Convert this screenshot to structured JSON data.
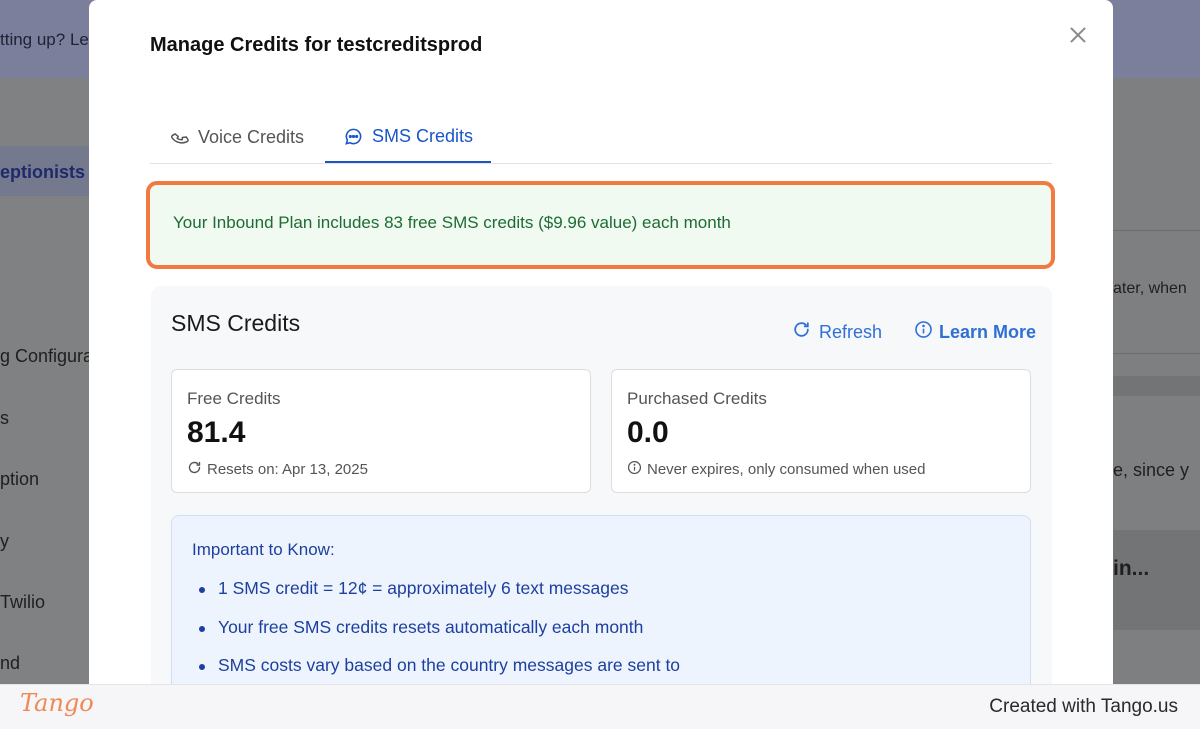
{
  "background": {
    "banner_text": "tting up? Le",
    "sidebar_items": [
      "eptionists",
      "g Configura",
      "s",
      "ption",
      "y",
      "Twilio",
      "nd"
    ],
    "right_texts": [
      "ater, when",
      "e, since y",
      "in..."
    ]
  },
  "modal": {
    "title": "Manage Credits for testcreditsprod",
    "close_icon": "close-icon",
    "tabs": [
      {
        "label": "Voice Credits",
        "icon": "phone-icon",
        "active": false
      },
      {
        "label": "SMS Credits",
        "icon": "chat-bubble-icon",
        "active": true
      }
    ],
    "notice": "Your Inbound Plan includes 83 free SMS credits ($9.96 value) each month",
    "credits_card": {
      "title": "SMS Credits",
      "refresh_label": "Refresh",
      "learn_more_label": "Learn More",
      "free": {
        "label": "Free Credits",
        "value": "81.4",
        "note": "Resets on: Apr 13, 2025"
      },
      "purchased": {
        "label": "Purchased Credits",
        "value": "0.0",
        "note": "Never expires, only consumed when used"
      },
      "info": {
        "title": "Important to Know:",
        "items": [
          "1 SMS credit = 12¢ = approximately 6 text messages",
          "Your free SMS credits resets automatically each month",
          "SMS costs vary based on the country messages are sent to"
        ]
      }
    }
  },
  "footer": {
    "logo": "Tango",
    "credit": "Created with Tango.us"
  },
  "colors": {
    "accent": "#1a55c9",
    "link": "#2f6fd6",
    "notice_border": "#f07a40",
    "notice_bg": "#f0faf1",
    "notice_text": "#1e6b34",
    "info_text": "#1d3f9e"
  }
}
